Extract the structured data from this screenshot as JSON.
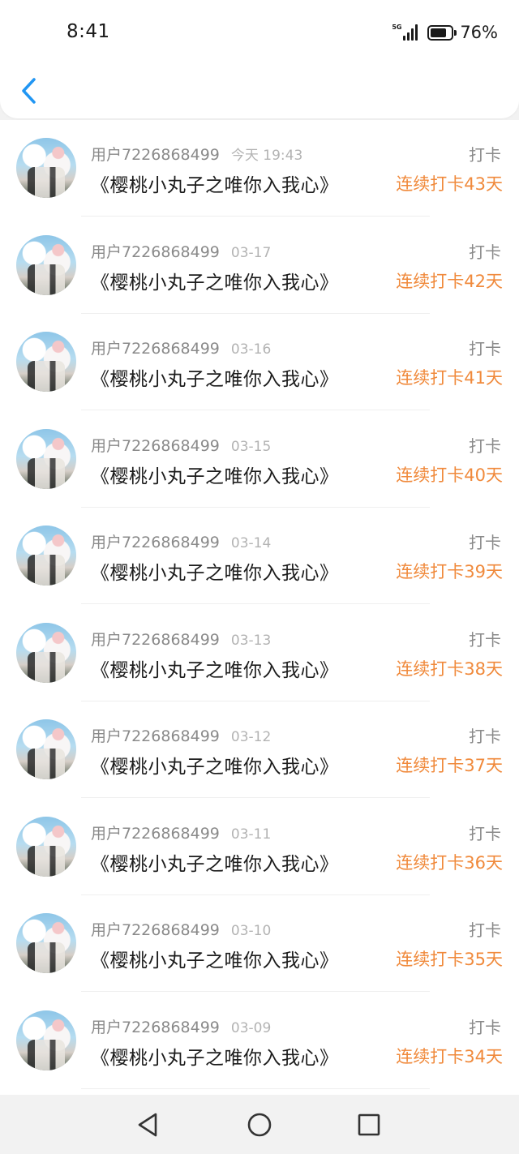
{
  "status_bar": {
    "time": "8:41",
    "network": "5G",
    "battery_percent": "76%"
  },
  "nav": {
    "back_icon": "chevron-left-icon"
  },
  "checkins": [
    {
      "user": "用户7226868499",
      "date": "今天 19:43",
      "book": "《樱桃小丸子之唯你入我心》",
      "action": "打卡",
      "streak": "连续打卡43天"
    },
    {
      "user": "用户7226868499",
      "date": "03-17",
      "book": "《樱桃小丸子之唯你入我心》",
      "action": "打卡",
      "streak": "连续打卡42天"
    },
    {
      "user": "用户7226868499",
      "date": "03-16",
      "book": "《樱桃小丸子之唯你入我心》",
      "action": "打卡",
      "streak": "连续打卡41天"
    },
    {
      "user": "用户7226868499",
      "date": "03-15",
      "book": "《樱桃小丸子之唯你入我心》",
      "action": "打卡",
      "streak": "连续打卡40天"
    },
    {
      "user": "用户7226868499",
      "date": "03-14",
      "book": "《樱桃小丸子之唯你入我心》",
      "action": "打卡",
      "streak": "连续打卡39天"
    },
    {
      "user": "用户7226868499",
      "date": "03-13",
      "book": "《樱桃小丸子之唯你入我心》",
      "action": "打卡",
      "streak": "连续打卡38天"
    },
    {
      "user": "用户7226868499",
      "date": "03-12",
      "book": "《樱桃小丸子之唯你入我心》",
      "action": "打卡",
      "streak": "连续打卡37天"
    },
    {
      "user": "用户7226868499",
      "date": "03-11",
      "book": "《樱桃小丸子之唯你入我心》",
      "action": "打卡",
      "streak": "连续打卡36天"
    },
    {
      "user": "用户7226868499",
      "date": "03-10",
      "book": "《樱桃小丸子之唯你入我心》",
      "action": "打卡",
      "streak": "连续打卡35天"
    },
    {
      "user": "用户7226868499",
      "date": "03-09",
      "book": "《樱桃小丸子之唯你入我心》",
      "action": "打卡",
      "streak": "连续打卡34天"
    }
  ],
  "system_nav": {
    "back_icon": "triangle-back-icon",
    "home_icon": "circle-home-icon",
    "recents_icon": "square-recents-icon"
  },
  "colors": {
    "accent": "#f08a3c",
    "back_arrow": "#2196f3"
  }
}
